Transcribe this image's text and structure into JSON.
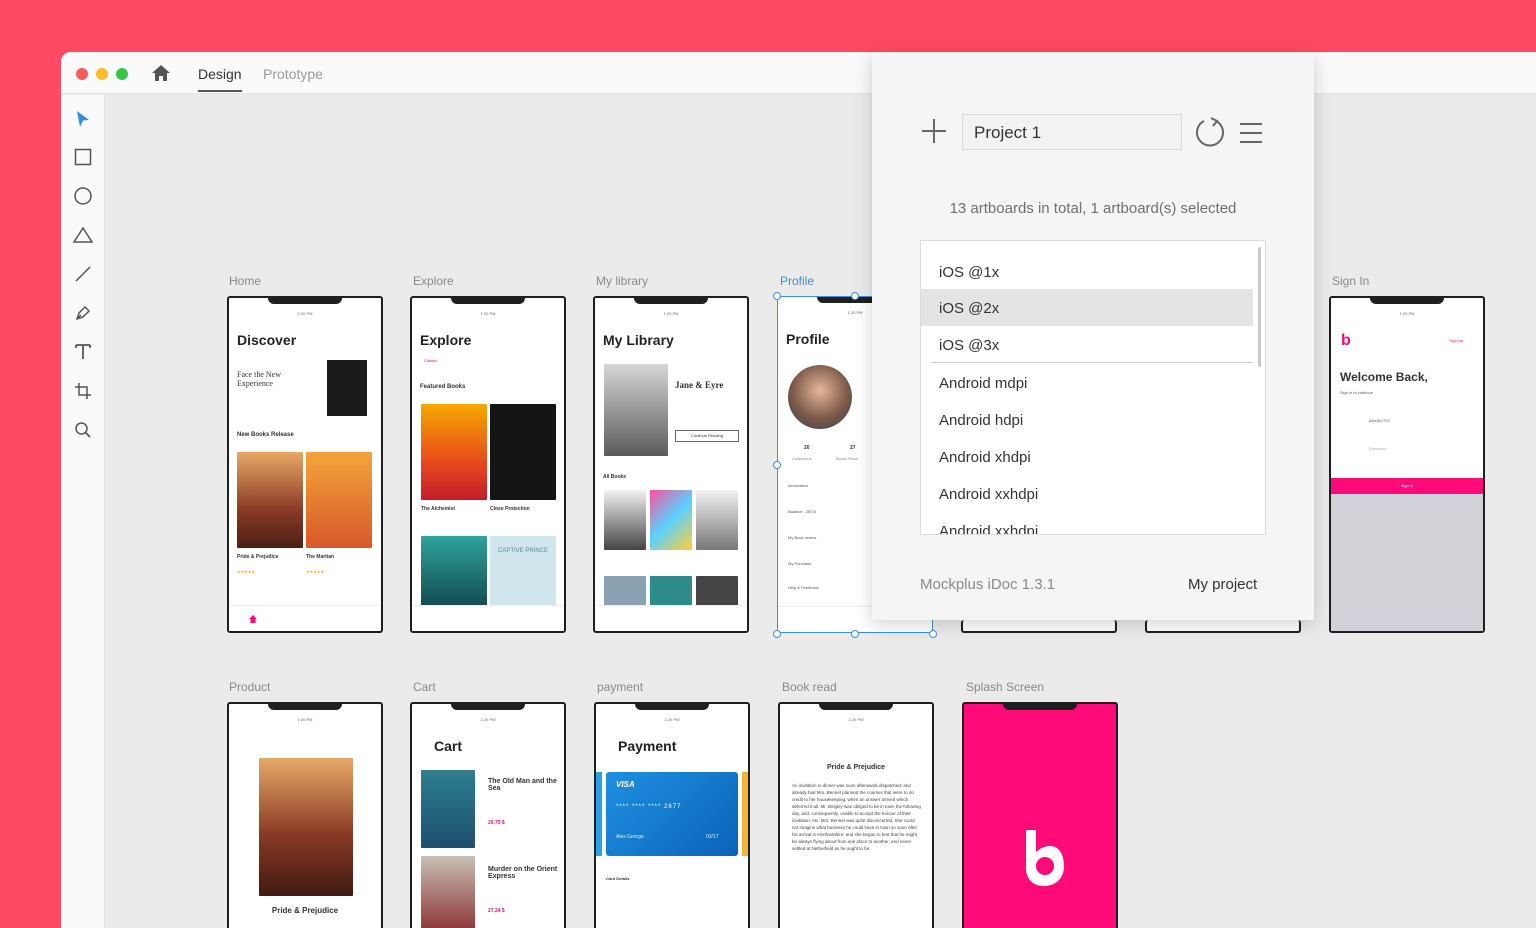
{
  "app": {
    "tabs": {
      "design": "Design",
      "prototype": "Prototype"
    }
  },
  "artboards": {
    "row1": [
      "Home",
      "Explore",
      "My library",
      "Profile",
      "Sign In"
    ],
    "row2": [
      "Product",
      "Cart",
      "payment",
      "Book read",
      "Splash Screen"
    ]
  },
  "screens": {
    "home": {
      "title": "Discover",
      "promo": "Face the New Experience",
      "section": "New Books Release",
      "book1": "Pride & Prejudice",
      "book2": "The Martian"
    },
    "explore": {
      "title": "Explore",
      "section": "Featured Books",
      "book1": "The Alchemist",
      "book2": "Close Protection",
      "book3": "CAPTIVE PRINCE"
    },
    "library": {
      "title": "My Library",
      "featured": "Jane & Eyre",
      "button": "Continue Reading",
      "section": "All Books"
    },
    "profile": {
      "title": "Profile",
      "stat1": "20",
      "stat1_label": "Collections",
      "stat2": "27",
      "stat2_label": "Books Read",
      "items": [
        "Information",
        "Balance : 250 $",
        "My Book review",
        "My Purchase",
        "Help & Feedback"
      ]
    },
    "signin": {
      "title": "Welcome Back,",
      "subtitle": "Sign in to continue",
      "link": "Sign Up",
      "user": "Alex@1723",
      "password": "Password",
      "button": "Sign In"
    },
    "product": {
      "title": "Pride & Prejudice"
    },
    "cart": {
      "title": "Cart",
      "item1": "The Old Man and the Sea",
      "price1": "20,75 $",
      "item2": "Murder on the Orient Express",
      "price2": "27,24 $"
    },
    "payment": {
      "title": "Payment",
      "card_brand": "VISA",
      "card_number": "**** **** **** 2677",
      "holder": "Alex George",
      "expiry": "03/17",
      "details": "Card Details"
    },
    "bookread": {
      "title": "Pride & Prejudice",
      "text": "An invitation to dinner was soon afterwards dispatched; and already had Mrs. Bennet planned the courses that were to do credit to her housekeeping, when an answer arrived which deferred it all. Mr. Bingley was obliged to be in town the following day, and, consequently, unable to accept the honour of their invitation, etc. Mrs. Bennet was quite disconcerted. She could not imagine what business he could have in town so soon after his arrival in Hertfordshire; and she began to fear that he might be always flying about from one place to another, and never settled at Netherfield as he ought to be."
    }
  },
  "panel": {
    "project_name": "Project 1",
    "artboard_count": "13 artboards in total, 1 artboard(s) selected",
    "export_options": [
      "iOS @1x",
      "iOS @2x",
      "iOS @3x",
      "Android mdpi",
      "Android hdpi",
      "Android xhdpi",
      "Android xxhdpi",
      "Android xxhdpi"
    ],
    "selected_option": "iOS @2x",
    "version": "Mockplus iDoc 1.3.1",
    "my_project": "My project"
  },
  "colors": {
    "background": "#ff4a63",
    "accent": "#ff0a78",
    "selection": "#3d8de0"
  },
  "icons": [
    "home-icon",
    "select-arrow-icon",
    "rectangle-icon",
    "ellipse-icon",
    "triangle-icon",
    "line-icon",
    "pen-icon",
    "text-icon",
    "artboard-icon",
    "zoom-icon",
    "plus-icon",
    "refresh-icon",
    "menu-icon"
  ]
}
